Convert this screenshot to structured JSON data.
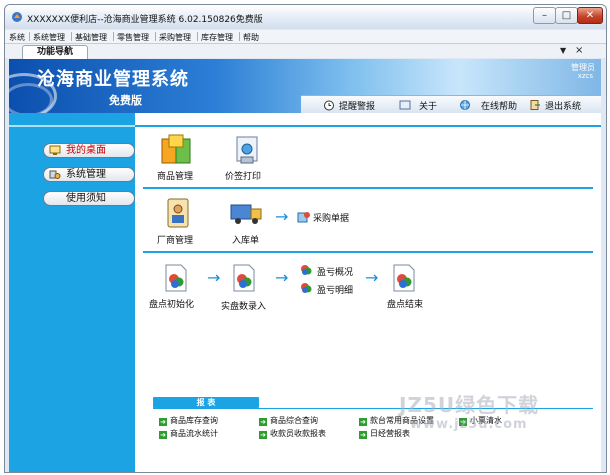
{
  "window": {
    "title": "XXXXXXX便利店--沧海商业管理系统 6.02.150826免费版"
  },
  "menu": [
    {
      "label": "系统"
    },
    {
      "label": "系统管理"
    },
    {
      "label": "基础管理"
    },
    {
      "label": "零售管理"
    },
    {
      "label": "采购管理"
    },
    {
      "label": "库存管理"
    },
    {
      "label": "帮助"
    }
  ],
  "nav_panel": {
    "tab_label": "功能导航",
    "pin_glyph": "▼",
    "close_glyph": "×"
  },
  "banner": {
    "title": "沧海商业管理系统",
    "subtitle": "免费版",
    "user_role": "管理员",
    "user_name": "xzcs"
  },
  "toolbar": [
    {
      "label": "提醒警报",
      "icon": "alarm-clock-icon"
    },
    {
      "label": "关于",
      "icon": "info-icon"
    },
    {
      "label": "在线帮助",
      "icon": "help-globe-icon"
    },
    {
      "label": "退出系统",
      "icon": "exit-icon"
    }
  ],
  "sidebar": [
    {
      "label": "我的桌面",
      "active": true,
      "icon": "desktop-icon"
    },
    {
      "label": "系统管理",
      "active": false,
      "icon": "settings-icon"
    },
    {
      "label": "使用须知",
      "active": false,
      "icon": ""
    }
  ],
  "workflow": {
    "row1": [
      {
        "label": "商品管理",
        "icon": "goods-box-icon"
      },
      {
        "label": "价签打印",
        "icon": "print-icon"
      }
    ],
    "row2": [
      {
        "label": "厂商管理",
        "icon": "supplier-icon"
      },
      {
        "label": "入库单",
        "icon": "truck-icon"
      },
      {
        "label": "采购单据",
        "icon": "purchase-doc-icon"
      }
    ],
    "row3": [
      {
        "label": "盘点初始化",
        "icon": "doc-icon"
      },
      {
        "label": "实盘数录入",
        "icon": "doc-icon"
      },
      {
        "label": "盈亏概况",
        "icon": "small-doc-icon"
      },
      {
        "label": "盈亏明细",
        "icon": "small-doc-icon"
      },
      {
        "label": "盘点结束",
        "icon": "doc-icon"
      }
    ]
  },
  "reports": {
    "heading": "报 表",
    "links": [
      {
        "label": "商品库存查询"
      },
      {
        "label": "商品综合查询"
      },
      {
        "label": "款台常用商品设置"
      },
      {
        "label": "小票清水"
      },
      {
        "label": "商品流水统计"
      },
      {
        "label": "收款员收款报表"
      },
      {
        "label": "日经营报表"
      }
    ]
  },
  "watermark": {
    "line1": "JZ5U绿色下载",
    "line2": "www.jz5u.com"
  },
  "colors": {
    "accent": "#1ca3e3",
    "banner_dark": "#0c4fae",
    "active_text": "#c40000"
  }
}
